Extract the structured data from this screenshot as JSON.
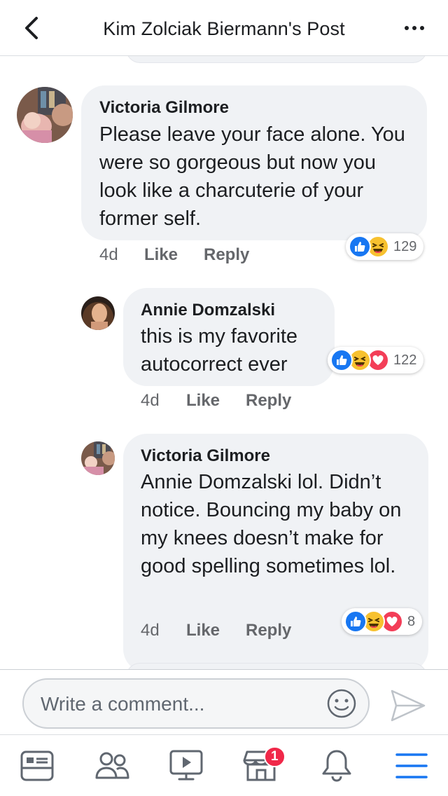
{
  "header": {
    "title": "Kim Zolciak Biermann's Post"
  },
  "comments": [
    {
      "author": "Victoria Gilmore",
      "text": "Please leave your face alone. You were so gorgeous but now you look like a charcuterie of your former self.",
      "time": "4d",
      "like_label": "Like",
      "reply_label": "Reply",
      "reaction_count": "129",
      "reaction_icons": [
        "like-icon",
        "haha-icon"
      ]
    },
    {
      "author": "Annie Domzalski",
      "text": "this is my favorite autocorrect ever",
      "time": "4d",
      "like_label": "Like",
      "reply_label": "Reply",
      "reaction_count": "122",
      "reaction_icons": [
        "like-icon",
        "haha-icon",
        "love-icon"
      ]
    },
    {
      "author": "Victoria Gilmore",
      "text": "Annie Domzalski lol. Didn’t notice. Bouncing my baby on my knees doesn’t make for good spelling sometimes lol.",
      "time": "4d",
      "like_label": "Like",
      "reply_label": "Reply",
      "reaction_count": "8",
      "reaction_icons": [
        "like-icon",
        "haha-icon",
        "love-icon"
      ]
    }
  ],
  "composer": {
    "placeholder": "Write a comment..."
  },
  "nav": {
    "items": [
      "news-feed-icon",
      "friends-icon",
      "watch-icon",
      "marketplace-icon",
      "notifications-icon",
      "menu-icon"
    ],
    "marketplace_badge": "1"
  },
  "colors": {
    "facebook_blue": "#1877f2",
    "bubble_gray": "#f0f2f5",
    "meta_gray": "#65676b",
    "haha_yellow": "#f7c12f",
    "love_red": "#f33e58",
    "badge_red": "#f02849"
  }
}
